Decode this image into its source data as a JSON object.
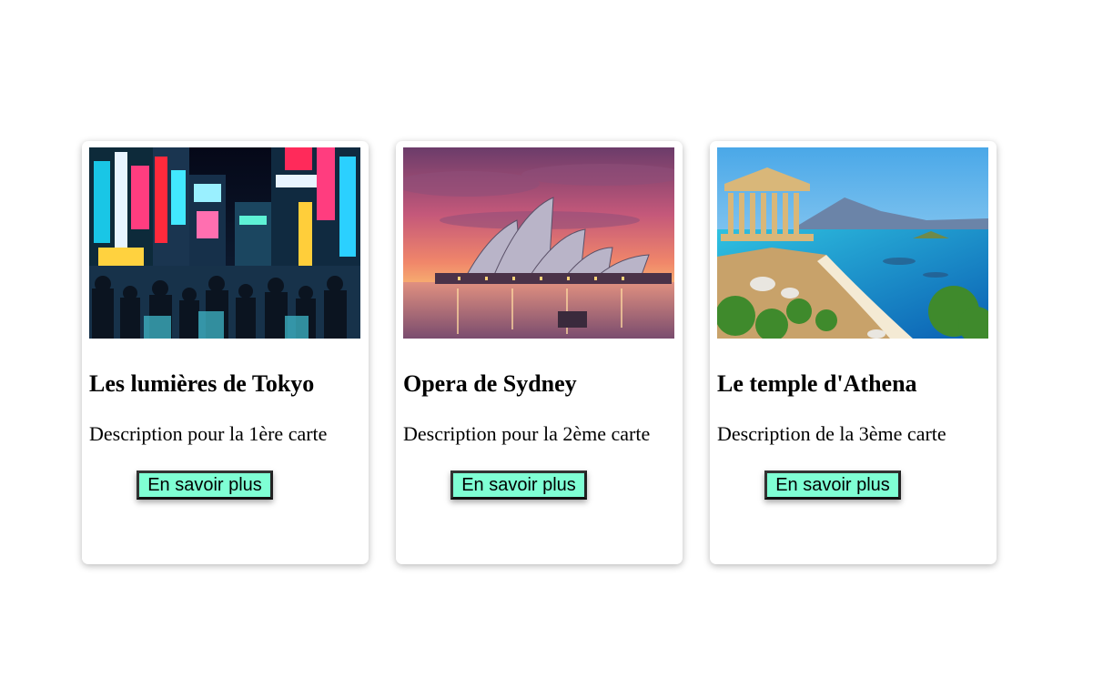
{
  "cards": [
    {
      "title": "Les lumières de Tokyo",
      "description": "Description pour la 1ère carte",
      "button_label": "En savoir plus",
      "image_subject": "tokyo-neon-street"
    },
    {
      "title": "Opera de Sydney",
      "description": "Description pour la 2ème carte",
      "button_label": "En savoir plus",
      "image_subject": "sydney-opera-house-sunset"
    },
    {
      "title": "Le temple d'Athena",
      "description": "Description de la 3ème carte",
      "button_label": "En savoir plus",
      "image_subject": "greek-temple-coast"
    }
  ],
  "colors": {
    "button_background": "#7fffd4",
    "card_background": "#ffffff"
  }
}
